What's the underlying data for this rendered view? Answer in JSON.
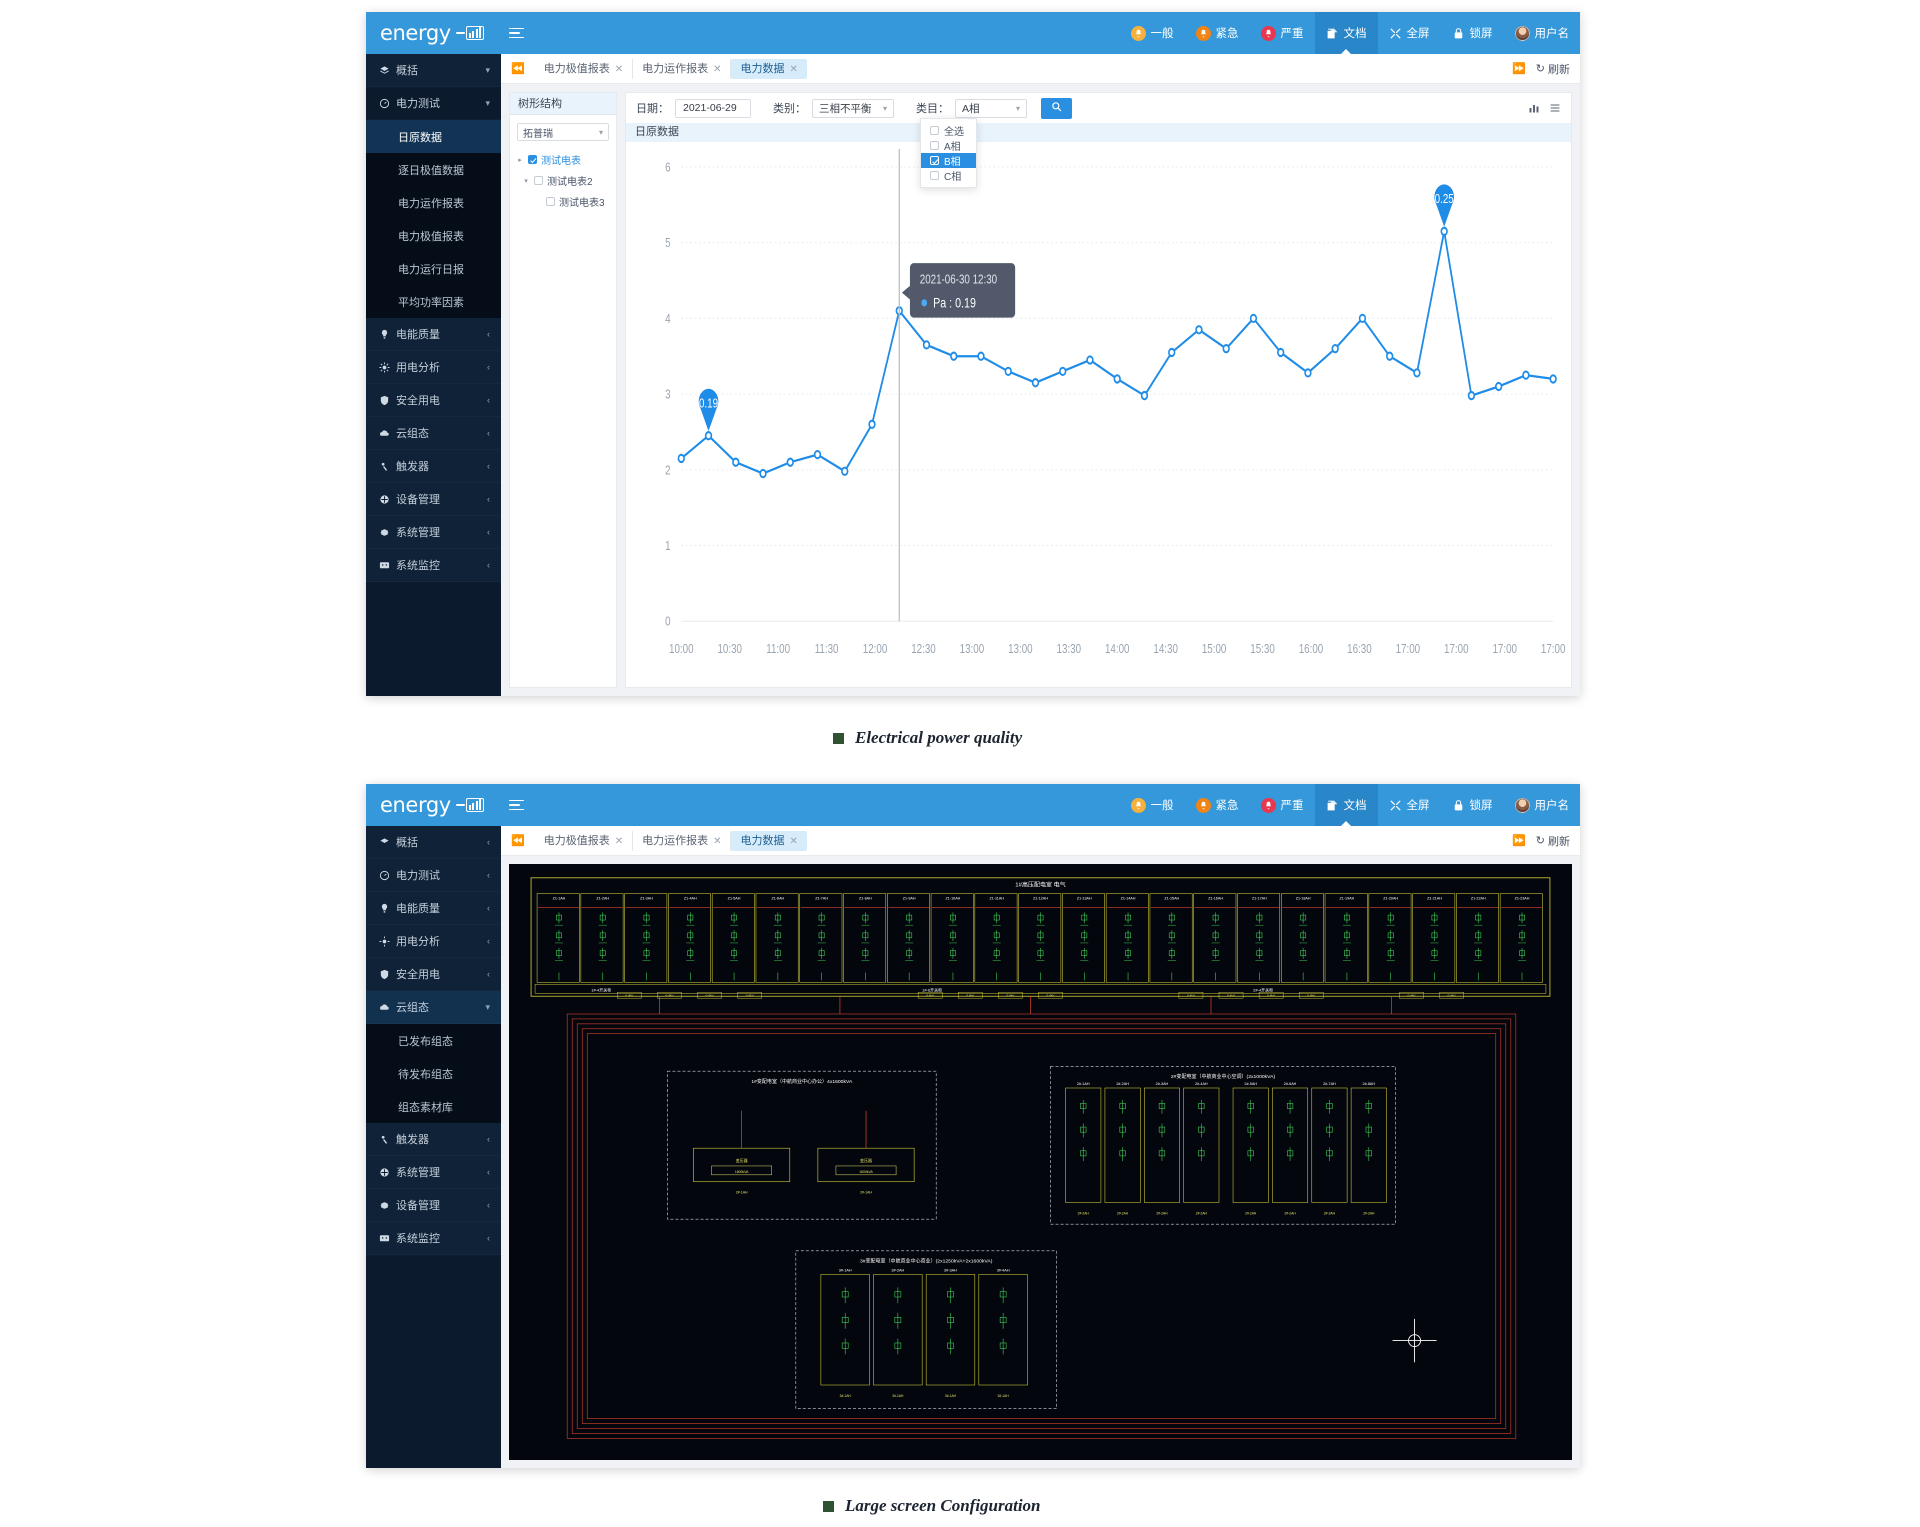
{
  "brand": {
    "name": "energy"
  },
  "topnav": {
    "items": [
      {
        "label": "一般",
        "icon": "bell-icon",
        "level": "normal"
      },
      {
        "label": "紧急",
        "icon": "bell-icon",
        "level": "urgent"
      },
      {
        "label": "严重",
        "icon": "bell-icon",
        "level": "severe"
      },
      {
        "label": "文档",
        "icon": "document-icon",
        "active": true
      },
      {
        "label": "全屏",
        "icon": "fullscreen-icon"
      },
      {
        "label": "锁屏",
        "icon": "lock-icon"
      },
      {
        "label": "用户名",
        "icon": "avatar-icon"
      }
    ]
  },
  "screen1": {
    "sidebar": {
      "items": [
        {
          "label": "概括",
          "icon": "layers-icon",
          "chevron": "down"
        },
        {
          "label": "电力测试",
          "icon": "gauge-icon",
          "chevron": "down",
          "expanded": true
        },
        {
          "label": "电能质量",
          "icon": "bulb-icon",
          "chevron": "left"
        },
        {
          "label": "用电分析",
          "icon": "analysis-icon",
          "chevron": "left"
        },
        {
          "label": "安全用电",
          "icon": "shield-icon",
          "chevron": "left"
        },
        {
          "label": "云组态",
          "icon": "cloud-icon",
          "chevron": "left"
        },
        {
          "label": "触发器",
          "icon": "trigger-icon",
          "chevron": "left"
        },
        {
          "label": "设备管理",
          "icon": "device-icon",
          "chevron": "left"
        },
        {
          "label": "系统管理",
          "icon": "gear-icon",
          "chevron": "left"
        },
        {
          "label": "系统监控",
          "icon": "monitor-icon",
          "chevron": "left"
        }
      ],
      "subitems": [
        {
          "label": "日原数据",
          "selected": true
        },
        {
          "label": "逐日极值数据",
          "selected": false
        },
        {
          "label": "电力运作报表",
          "selected": false
        },
        {
          "label": "电力极值报表",
          "selected": false
        },
        {
          "label": "电力运行日报",
          "selected": false
        },
        {
          "label": "平均功率因素",
          "selected": false
        }
      ]
    },
    "tabs": [
      {
        "label": "电力极值报表",
        "active": false
      },
      {
        "label": "电力运作报表",
        "active": false
      },
      {
        "label": "电力数据",
        "active": true
      }
    ],
    "tabbar_right": {
      "collapse_icon": "chevron-right-double-icon",
      "refresh_label": "刷新",
      "refresh_icon": "refresh-icon"
    },
    "tree": {
      "title": "树形结构",
      "select_value": "拓普瑞",
      "nodes": [
        {
          "label": "测试电表",
          "depth": 0,
          "checked": true,
          "twisty": "right",
          "highlight": true
        },
        {
          "label": "测试电表2",
          "depth": 1,
          "checked": false,
          "twisty": "down",
          "highlight": false
        },
        {
          "label": "测试电表3",
          "depth": 2,
          "checked": false,
          "twisty": "none",
          "highlight": false
        }
      ]
    },
    "filters": {
      "date_label": "日期：",
      "date_value": "2021-06-29",
      "category_label": "类别：",
      "category_value": "三相不平衡",
      "item_label": "类目：",
      "item_value": "A相",
      "search_icon": "search-icon",
      "view_chart_icon": "bar-chart-icon",
      "view_list_icon": "list-icon"
    },
    "dropdown": {
      "options": [
        {
          "label": "全选",
          "checked": false,
          "active": false
        },
        {
          "label": "A相",
          "checked": false,
          "active": false
        },
        {
          "label": "B相",
          "checked": true,
          "active": true
        },
        {
          "label": "C相",
          "checked": false,
          "active": false
        }
      ]
    },
    "panel_title": "日原数据",
    "tooltip": {
      "time": "2021-06-30 12:30",
      "series": "Pa",
      "value": "0.19"
    },
    "markers": [
      {
        "label": "0.19",
        "type": "min"
      },
      {
        "label": "0.25",
        "type": "max"
      }
    ]
  },
  "chart_data": {
    "type": "line",
    "title": "日原数据",
    "series_name": "Pa",
    "xlabel": "",
    "ylabel": "",
    "ylim": [
      0,
      6
    ],
    "yticks": [
      0,
      1,
      2,
      3,
      4,
      5,
      6
    ],
    "grid": true,
    "legend": "none",
    "color": "#1f8ce8",
    "xticks": [
      "10:00",
      "10:30",
      "11:00",
      "11:30",
      "12:00",
      "12:30",
      "13:00",
      "13:00",
      "13:30",
      "14:00",
      "14:30",
      "15:00",
      "15:30",
      "16:00",
      "16:30",
      "17:00",
      "17:00",
      "17:00",
      "17:00"
    ],
    "x": [
      "10:00",
      "10:15",
      "10:30",
      "10:45",
      "11:00",
      "11:15",
      "11:30",
      "11:45",
      "12:00",
      "12:15",
      "12:30",
      "12:45",
      "13:00",
      "13:15",
      "13:30",
      "13:45",
      "14:00",
      "14:15",
      "14:30",
      "14:45",
      "15:00",
      "15:15",
      "15:30",
      "15:45",
      "16:00",
      "16:15",
      "16:30",
      "16:45",
      "17:00",
      "17:15",
      "17:30",
      "17:45"
    ],
    "values": [
      2.15,
      2.45,
      2.1,
      1.95,
      2.1,
      2.2,
      1.98,
      2.6,
      4.1,
      3.65,
      3.5,
      3.5,
      3.3,
      3.15,
      3.3,
      3.45,
      3.2,
      2.98,
      3.55,
      3.85,
      3.6,
      4.0,
      3.55,
      3.28,
      3.6,
      4.0,
      3.5,
      3.28,
      5.15,
      2.98,
      3.1,
      3.25,
      3.2
    ],
    "annotations": [
      {
        "label": "0.19",
        "x_index": 1,
        "kind": "pin-min"
      },
      {
        "label": "0.25",
        "x_index": 28,
        "kind": "pin-max"
      }
    ],
    "tooltip": {
      "x": "2021-06-30 12:30",
      "series": "Pa",
      "value": 0.19
    }
  },
  "screen2": {
    "sidebar": {
      "items": [
        {
          "label": "概括",
          "icon": "layers-icon",
          "chevron": "left"
        },
        {
          "label": "电力测试",
          "icon": "gauge-icon",
          "chevron": "left"
        },
        {
          "label": "电能质量",
          "icon": "bulb-icon",
          "chevron": "left"
        },
        {
          "label": "用电分析",
          "icon": "analysis-icon",
          "chevron": "left"
        },
        {
          "label": "安全用电",
          "icon": "shield-icon",
          "chevron": "left"
        },
        {
          "label": "云组态",
          "icon": "cloud-icon",
          "chevron": "down",
          "expanded": true
        },
        {
          "label": "触发器",
          "icon": "trigger-icon",
          "chevron": "left"
        },
        {
          "label": "系统管理",
          "icon": "gear-icon",
          "chevron": "left"
        },
        {
          "label": "设备管理",
          "icon": "device-icon",
          "chevron": "left"
        },
        {
          "label": "系统监控",
          "icon": "monitor-icon",
          "chevron": "left"
        }
      ],
      "subitems": [
        {
          "label": "已发布组态",
          "selected": false
        },
        {
          "label": "待发布组态",
          "selected": false
        },
        {
          "label": "组态素材库",
          "selected": false
        }
      ]
    },
    "tabs": [
      {
        "label": "电力极值报表",
        "active": false
      },
      {
        "label": "电力运作报表",
        "active": false
      },
      {
        "label": "电力数据",
        "active": true
      }
    ],
    "tabbar_right": {
      "refresh_label": "刷新"
    },
    "diagram": {
      "title": "1#高压配电室 电气",
      "footer_left": "1#-4开关柜",
      "footers": [
        "1#-4开关柜",
        "1#-6开关柜",
        "2#-4开关柜"
      ],
      "panel_titles": [
        "1#变配电室（中航商业中心办公）4x1600kVA",
        "2#变配电室（中航商业中心空调）(2x1000kVA)",
        "3#变配电室（中航商业中心商业）(2x1250kVA+2x1600kVA)"
      ],
      "cabinet_labels": [
        "Z1-1AH",
        "Z1-2AH",
        "Z1-3AH",
        "Z1-4AH",
        "Z1-5AH",
        "Z1-6AH",
        "Z1-7AH",
        "Z1-8AH",
        "Z1-9AH",
        "Z1-10AH",
        "Z1-11AH",
        "Z1-12AH",
        "Z1-13AH",
        "Z1-14AH",
        "Z1-15AH",
        "Z1-16AH",
        "Z1-17AH",
        "Z1-18AH",
        "Z1-19AH",
        "Z1-20AH",
        "Z1-21AH",
        "Z1-22AH",
        "Z1-23AH"
      ],
      "sub_cabinet_labels": [
        "2#-1AH",
        "2#-2AH",
        "2#-3AH",
        "2#-4AH",
        "2#-5AH",
        "2#-6AH",
        "2#-7AH",
        "2#-8AH"
      ],
      "low_cabinet_labels": [
        "3#-1AH",
        "3#-2AH",
        "3#-3AH",
        "3#-4AH"
      ]
    }
  },
  "captions": [
    {
      "text": "Electrical power quality"
    },
    {
      "text": "Large screen Configuration"
    }
  ]
}
